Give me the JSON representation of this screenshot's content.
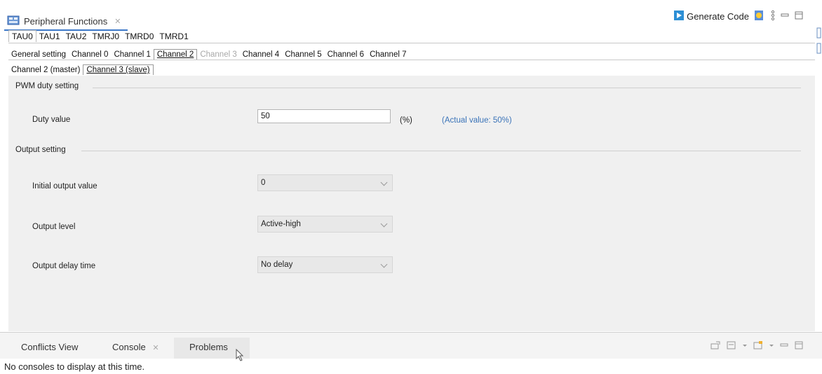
{
  "view": {
    "title": "Peripheral Functions",
    "close_label": "✕"
  },
  "toolbar": {
    "generate_label": "Generate Code"
  },
  "peripheral_tabs": [
    "TAU0",
    "TAU1",
    "TAU2",
    "TMRJ0",
    "TMRD0",
    "TMRD1"
  ],
  "channel_tabs": [
    "General setting",
    "Channel 0",
    "Channel 1",
    "Channel 2",
    "Channel 3",
    "Channel 4",
    "Channel 5",
    "Channel 6",
    "Channel 7"
  ],
  "sub_tabs": [
    "Channel 2 (master)",
    "Channel 3 (slave)"
  ],
  "pwm": {
    "section_title": "PWM duty setting",
    "duty_label": "Duty value",
    "duty_value": "50",
    "unit": "(%)",
    "actual": "(Actual value: 50%)"
  },
  "output": {
    "section_title": "Output setting",
    "initial_label": "Initial output value",
    "initial_value": "0",
    "level_label": "Output level",
    "level_value": "Active-high",
    "delay_label": "Output delay time",
    "delay_value": "No delay"
  },
  "bottom": {
    "tabs": [
      "Conflicts View",
      "Console",
      "Problems"
    ],
    "console_close": "✕",
    "message": "No consoles to display at this time."
  },
  "colors": {
    "accent": "#3c78c8",
    "actual_value": "#3a73b8",
    "panel_bg": "#f0f0f0"
  }
}
